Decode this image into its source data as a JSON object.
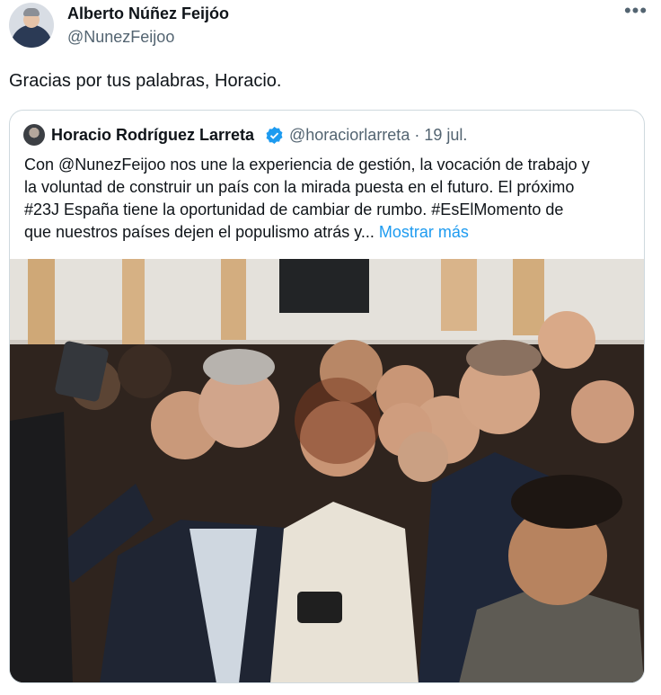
{
  "author": {
    "name": "Alberto Núñez Feijóo",
    "handle": "@NunezFeijoo",
    "avatar_icon": "profile-photo"
  },
  "menu_icon": "more-horizontal-icon",
  "tweet": {
    "text": "Gracias por tus palabras, Horacio."
  },
  "quote": {
    "name": "Horacio Rodríguez Larreta",
    "verified_icon": "verified-badge-icon",
    "verified_color": "#1d9bf0",
    "meta": "@horaciorlarreta · 19 jul.",
    "lines": [
      "Con @NunezFeijoo nos une la experiencia de gestión, la vocación de trabajo y",
      "la voluntad de construir un país con la mirada puesta en el futuro. El próximo",
      "#23J España tiene la oportunidad de cambiar de rumbo. #EsElMomento de"
    ],
    "last_line": "que nuestros países dejen el populismo atrás y...",
    "show_more": "Mostrar más",
    "link_color": "#1d9bf0"
  },
  "photo": {
    "description_icon": "selfie-photo"
  }
}
